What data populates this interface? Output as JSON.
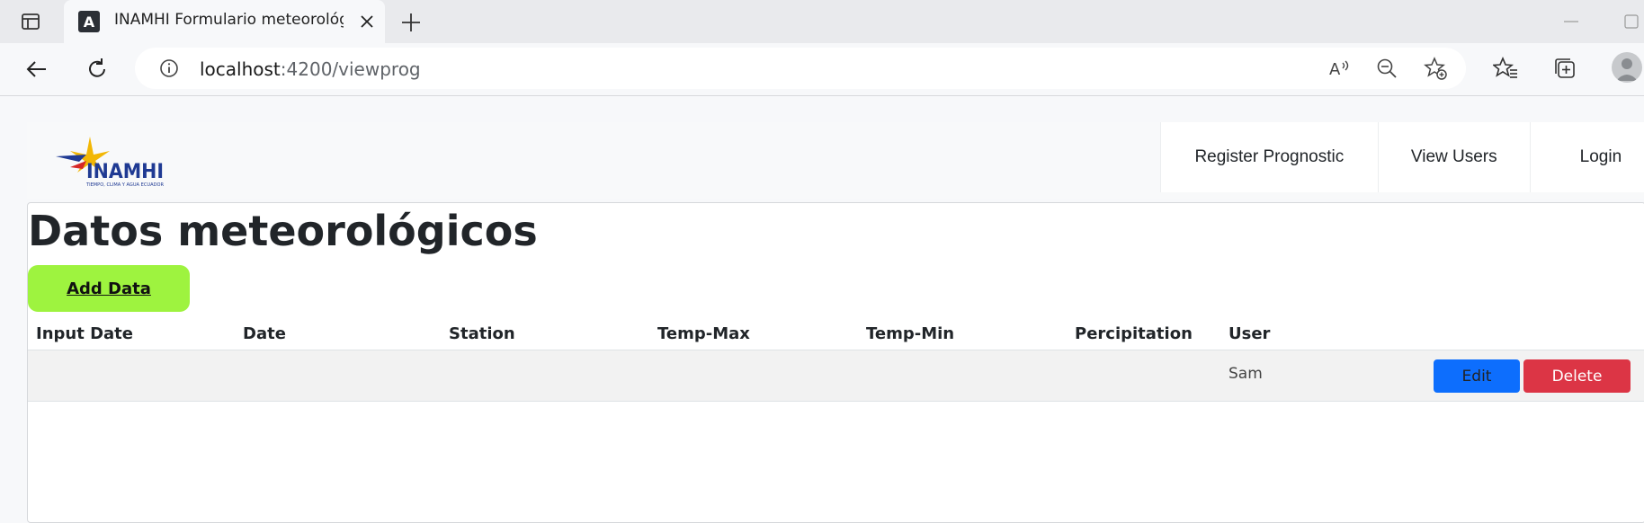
{
  "browser": {
    "tab_title": "INAMHI Formulario meteorológico",
    "url_host": "localhost",
    "url_rest": ":4200/viewprog",
    "icons": [
      "window-icon",
      "angular-favicon-icon",
      "close-icon",
      "plus-icon",
      "minimize-icon",
      "maximize-icon",
      "back-arrow-icon",
      "reload-icon",
      "info-icon",
      "read-aloud-icon",
      "zoom-out-icon",
      "add-favorite-icon",
      "favorites-icon",
      "collections-icon",
      "profile-icon"
    ]
  },
  "navbar": {
    "brand": "INAMHI",
    "brand_tagline": "TIEMPO, CLIMA Y AGUA ECUADOR",
    "links": [
      "Register Prognostic",
      "View Users",
      "Login"
    ]
  },
  "page": {
    "title": "Datos meteorológicos",
    "add_button": "Add Data"
  },
  "table": {
    "headers": [
      "Input Date",
      "Date",
      "Station",
      "Temp-Max",
      "Temp-Min",
      "Percipitation",
      "User"
    ],
    "rows": [
      {
        "input_date": "",
        "date": "",
        "station": "",
        "temp_max": "",
        "temp_min": "",
        "percipitation": "",
        "user": "Sam",
        "edit_label": "Edit",
        "delete_label": "Delete"
      }
    ]
  },
  "colors": {
    "add_button": "#9ef33f",
    "edit_button": "#0d6efd",
    "delete_button": "#dc3545"
  }
}
